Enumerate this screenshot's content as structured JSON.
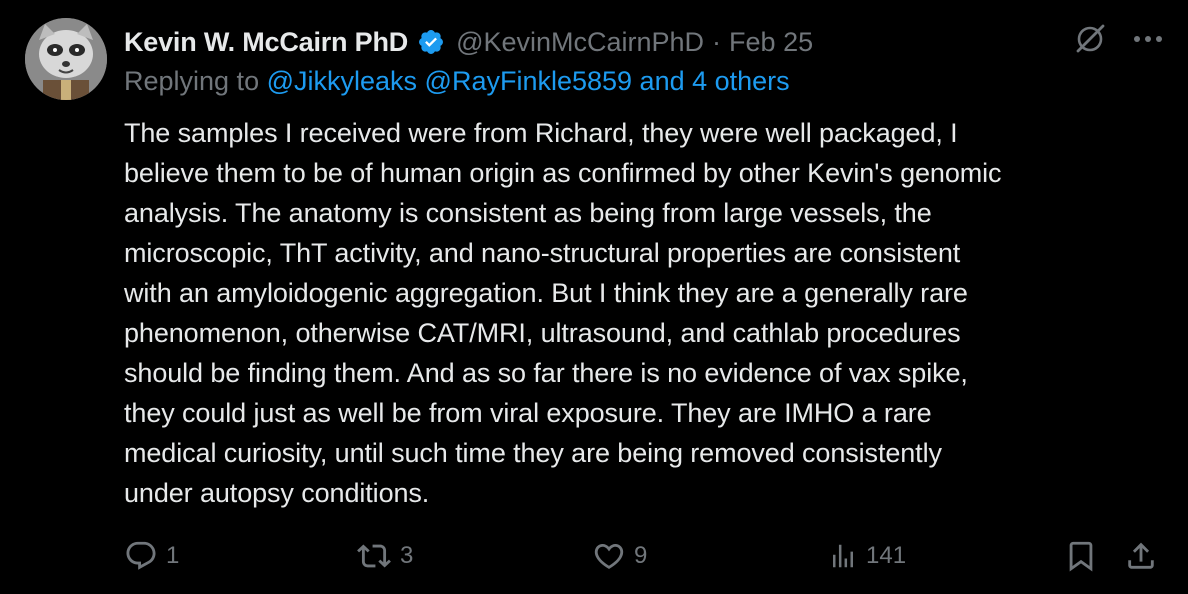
{
  "author": {
    "display_name": "Kevin W. McCairn PhD",
    "handle": "@KevinMcCairnPhD",
    "separator": "·",
    "date": "Feb 25",
    "verified": true
  },
  "reply": {
    "prefix": "Replying to",
    "users": "@Jikkyleaks @RayFinkle5859 and 4 others"
  },
  "body": "The samples I received were from Richard, they were well packaged, I\nbelieve them to be of human origin as confirmed by other Kevin's genomic\nanalysis. The anatomy is consistent as being from large vessels, the\nmicroscopic, ThT activity, and nano-structural properties are consistent\nwith an amyloidogenic aggregation. But I think they are a generally rare\nphenomenon, otherwise CAT/MRI, ultrasound, and cathlab procedures\nshould be finding them. And as so far there is no evidence of vax spike,\nthey could just as well be from viral exposure. They are IMHO a rare\nmedical curiosity, until such time they are being removed consistently\nunder autopsy conditions.",
  "actions": {
    "replies": "1",
    "reposts": "3",
    "likes": "9",
    "views": "141"
  },
  "icons": {
    "verified": "verified-badge-icon",
    "grok": "grok-icon",
    "more": "more-icon",
    "reply": "reply-icon",
    "repost": "repost-icon",
    "like": "heart-icon",
    "views": "views-icon",
    "bookmark": "bookmark-icon",
    "share": "share-icon"
  },
  "colors": {
    "background": "#000000",
    "text": "#e7e9ea",
    "muted": "#71767b",
    "link": "#1d9bf0"
  }
}
